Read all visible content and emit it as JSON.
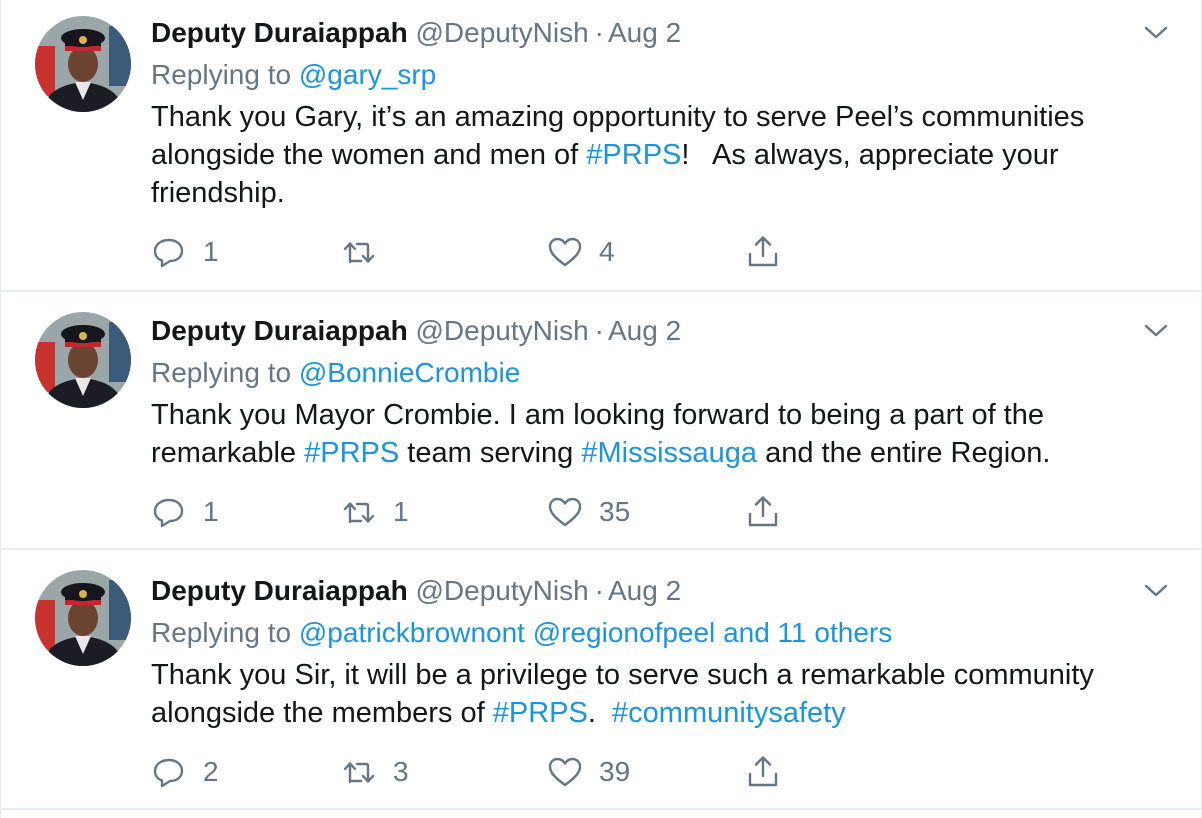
{
  "tweets": [
    {
      "name": "Deputy Duraiappah",
      "handle": "@DeputyNish",
      "separator": "·",
      "date": "Aug 2",
      "replying_prefix": "Replying to",
      "replying_to": "@gary_srp",
      "replying_suffix": "",
      "body": [
        {
          "text": "Thank you Gary, it’s an amazing opportunity to serve Peel’s communities alongside the women and men of ",
          "link": false
        },
        {
          "text": "#PRPS",
          "link": true
        },
        {
          "text": "!   As always, appreciate your friendship.",
          "link": false
        }
      ],
      "replies": "1",
      "retweets": "",
      "likes": "4"
    },
    {
      "name": "Deputy Duraiappah",
      "handle": "@DeputyNish",
      "separator": "·",
      "date": "Aug 2",
      "replying_prefix": "Replying to",
      "replying_to": "@BonnieCrombie",
      "replying_suffix": "",
      "body": [
        {
          "text": "Thank you Mayor Crombie. I am looking forward to being a part of the remarkable ",
          "link": false
        },
        {
          "text": "#PRPS",
          "link": true
        },
        {
          "text": " team serving ",
          "link": false
        },
        {
          "text": "#Mississauga",
          "link": true
        },
        {
          "text": " and the entire Region.",
          "link": false
        }
      ],
      "replies": "1",
      "retweets": "1",
      "likes": "35"
    },
    {
      "name": "Deputy Duraiappah",
      "handle": "@DeputyNish",
      "separator": "·",
      "date": "Aug 2",
      "replying_prefix": "Replying to",
      "replying_to": "@patrickbrownont @regionofpeel",
      "replying_suffix": "and 11 others",
      "body": [
        {
          "text": "Thank you Sir, it will be a privilege to serve such a remarkable community alongside the members of ",
          "link": false
        },
        {
          "text": "#PRPS",
          "link": true
        },
        {
          "text": ".  ",
          "link": false
        },
        {
          "text": "#communitysafety",
          "link": true
        }
      ],
      "replies": "2",
      "retweets": "3",
      "likes": "39"
    }
  ],
  "colors": {
    "link": "#1b95e0",
    "secondary_text": "#657786",
    "primary_text": "#14171a",
    "divider": "#e6ecf0"
  },
  "icons": [
    "avatar",
    "chevron-down-icon",
    "reply-icon",
    "retweet-icon",
    "like-icon",
    "share-icon"
  ]
}
